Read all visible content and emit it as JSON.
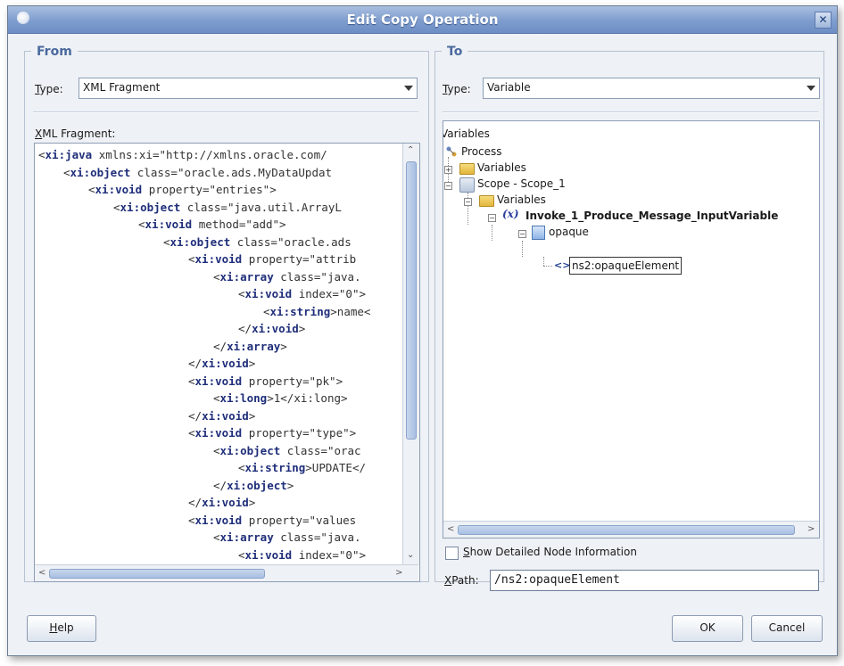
{
  "window": {
    "title": "Edit Copy Operation"
  },
  "from": {
    "legend": "From",
    "type_label": "Type:",
    "type_value": "XML Fragment",
    "editor_label": "XML Fragment:",
    "code_lines": [
      {
        "i": 0,
        "t": "<",
        "tag": "xi:java",
        "rest": " xmlns:xi=\"http://xmlns.oracle.com/"
      },
      {
        "i": 1,
        "t": "<",
        "tag": "xi:object",
        "rest": " class=\"oracle.ads.MyDataUpdat"
      },
      {
        "i": 2,
        "t": "<",
        "tag": "xi:void",
        "rest": " property=\"entries\">"
      },
      {
        "i": 3,
        "t": "<",
        "tag": "xi:object",
        "rest": " class=\"java.util.ArrayL"
      },
      {
        "i": 4,
        "t": "<",
        "tag": "xi:void",
        "rest": " method=\"add\">"
      },
      {
        "i": 5,
        "t": "<",
        "tag": "xi:object",
        "rest": " class=\"oracle.ads"
      },
      {
        "i": 6,
        "t": "<",
        "tag": "xi:void",
        "rest": " property=\"attrib"
      },
      {
        "i": 7,
        "t": "<",
        "tag": "xi:array",
        "rest": " class=\"java."
      },
      {
        "i": 8,
        "t": "<",
        "tag": "xi:void",
        "rest": " index=\"0\">"
      },
      {
        "i": 9,
        "t": "<",
        "tag": "xi:string",
        "rest": ">name<"
      },
      {
        "i": 8,
        "t": "</",
        "tag": "xi:void",
        "rest": ">"
      },
      {
        "i": 7,
        "t": "</",
        "tag": "xi:array",
        "rest": ">"
      },
      {
        "i": 6,
        "t": "</",
        "tag": "xi:void",
        "rest": ">"
      },
      {
        "i": 6,
        "t": "<",
        "tag": "xi:void",
        "rest": " property=\"pk\">"
      },
      {
        "i": 7,
        "t": "<",
        "tag": "xi:long",
        "rest": ">1</xi:long>"
      },
      {
        "i": 6,
        "t": "</",
        "tag": "xi:void",
        "rest": ">"
      },
      {
        "i": 6,
        "t": "<",
        "tag": "xi:void",
        "rest": " property=\"type\">"
      },
      {
        "i": 7,
        "t": "<",
        "tag": "xi:object",
        "rest": " class=\"orac"
      },
      {
        "i": 8,
        "t": "<",
        "tag": "xi:string",
        "rest": ">UPDATE</"
      },
      {
        "i": 7,
        "t": "</",
        "tag": "xi:object",
        "rest": ">"
      },
      {
        "i": 6,
        "t": "</",
        "tag": "xi:void",
        "rest": ">"
      },
      {
        "i": 6,
        "t": "<",
        "tag": "xi:void",
        "rest": " property=\"values"
      },
      {
        "i": 7,
        "t": "<",
        "tag": "xi:array",
        "rest": " class=\"java."
      },
      {
        "i": 8,
        "t": "<",
        "tag": "xi:void",
        "rest": " index=\"0\">"
      }
    ]
  },
  "to": {
    "legend": "To",
    "type_label": "Type:",
    "type_value": "Variable",
    "tree": {
      "root_label": "Variables",
      "process": "Process",
      "variables_1": "Variables",
      "scope": "Scope - Scope_1",
      "variables_2": "Variables",
      "variable": "Invoke_1_Produce_Message_InputVariable",
      "part": "opaque",
      "element": "ns2:opaqueElement"
    },
    "show_detail_label": "Show Detailed Node Information",
    "xpath_label": "XPath:",
    "xpath_value": "/ns2:opaqueElement"
  },
  "buttons": {
    "help": "Help",
    "ok": "OK",
    "cancel": "Cancel"
  }
}
